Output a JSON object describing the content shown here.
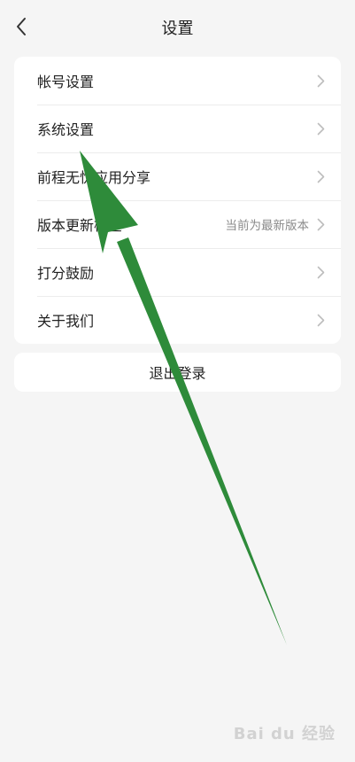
{
  "header": {
    "title": "设置",
    "back_icon": "chevron-left-icon"
  },
  "menu": {
    "items": [
      {
        "label": "帐号设置",
        "value": ""
      },
      {
        "label": "系统设置",
        "value": ""
      },
      {
        "label": "前程无忧应用分享",
        "value": ""
      },
      {
        "label": "版本更新检查",
        "value": "当前为最新版本"
      },
      {
        "label": "打分鼓励",
        "value": ""
      },
      {
        "label": "关于我们",
        "value": ""
      }
    ]
  },
  "logout": {
    "label": "退出登录"
  },
  "annotation": {
    "type": "arrow",
    "color": "#2e8b3a",
    "points_to": "系统设置"
  },
  "watermark": {
    "text": "Bai du 经验"
  },
  "colors": {
    "background": "#f5f5f5",
    "card": "#ffffff",
    "arrow": "#2e8b3a"
  }
}
